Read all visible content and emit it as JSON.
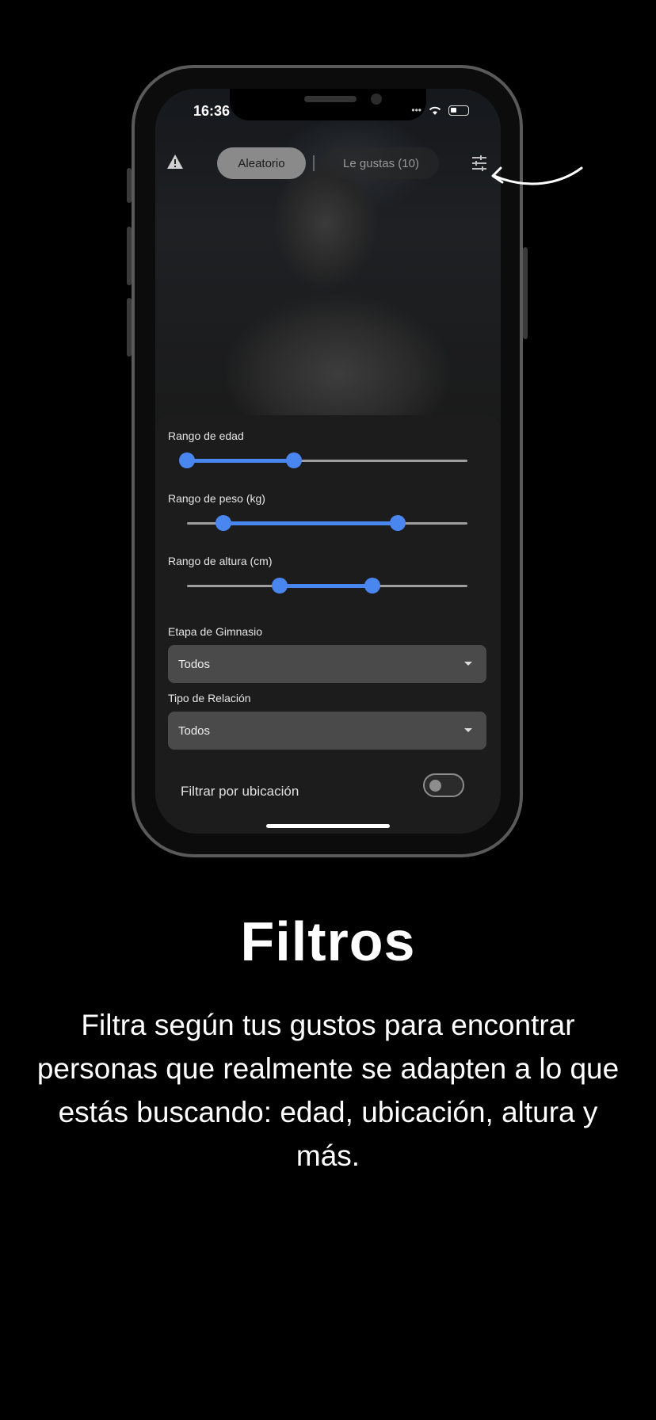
{
  "status": {
    "time": "16:36"
  },
  "tabs": [
    {
      "label": "Aleatorio"
    },
    {
      "label": "Le gustas (10)"
    }
  ],
  "filters": {
    "age": {
      "label": "Rango de edad",
      "low": 0.0,
      "high": 0.38
    },
    "weight": {
      "label": "Rango de peso (kg)",
      "low": 0.13,
      "high": 0.75
    },
    "height": {
      "label": "Rango de altura (cm)",
      "low": 0.33,
      "high": 0.66
    },
    "gym_stage": {
      "label": "Etapa de Gimnasio",
      "value": "Todos"
    },
    "relation_type": {
      "label": "Tipo de Relación",
      "value": "Todos"
    },
    "location": {
      "label": "Filtrar por ubicación",
      "enabled": false
    }
  },
  "headline": "Filtros",
  "description": "Filtra según tus gustos para encontrar personas que realmente se adapten a lo que estás buscando: edad, ubicación, altura y más.",
  "colors": {
    "accent": "#4a86ef",
    "background": "#000000",
    "sheet": "#1c1c1c"
  }
}
